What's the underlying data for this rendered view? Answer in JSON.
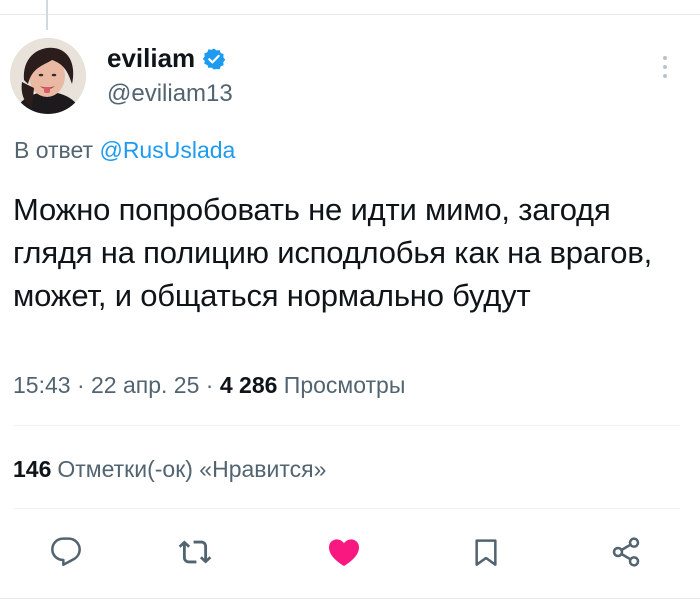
{
  "author": {
    "display_name": "eviliam",
    "handle": "@eviliam13",
    "verified": true
  },
  "reply_context": {
    "prefix": "В ответ",
    "mention": "@RusUslada"
  },
  "tweet": {
    "text": "Можно попробовать не идти мимо, загодя глядя на полицию исподлобья как на врагов, может, и общаться нормально будут",
    "time": "15:43",
    "date": "22 апр. 25",
    "separator": "·",
    "views_count": "4 286",
    "views_label": "Просмотры"
  },
  "engagement": {
    "likes_count": "146",
    "likes_label": "Отметки(-ок) «Нравится»"
  },
  "colors": {
    "accent": "#1d9bf0",
    "like": "#f91880",
    "text": "#0f1419",
    "secondary": "#536471"
  },
  "actions": [
    {
      "name": "reply",
      "icon": "reply-icon"
    },
    {
      "name": "retweet",
      "icon": "retweet-icon"
    },
    {
      "name": "like",
      "icon": "heart-filled-icon",
      "state": "liked"
    },
    {
      "name": "bookmark",
      "icon": "bookmark-icon"
    },
    {
      "name": "share",
      "icon": "share-icon"
    }
  ]
}
